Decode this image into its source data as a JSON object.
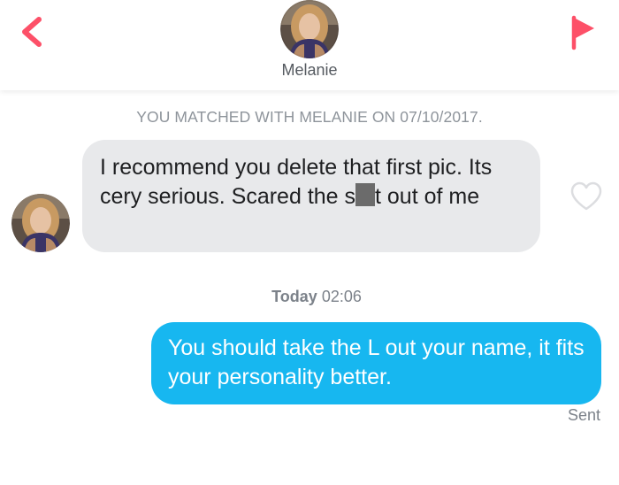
{
  "header": {
    "contact_name": "Melanie",
    "back_icon": "chevron-left-icon",
    "flag_icon": "flag-icon",
    "accent_color": "#fd5068"
  },
  "match_notice": "YOU MATCHED WITH MELANIE ON 07/10/2017.",
  "messages": [
    {
      "direction": "incoming",
      "text_before_censor": "I recommend you delete that first pic. Its cery serious. Scared the s",
      "text_after_censor": "t out of me",
      "like_icon": "heart-outline-icon",
      "bubble_color": "#e8e9eb"
    },
    {
      "direction": "outgoing",
      "text": "You should take the L out your name, it fits your personality better.",
      "status": "Sent",
      "bubble_color": "#17b7f0"
    }
  ],
  "timestamp": {
    "day": "Today",
    "time": "02:06"
  }
}
